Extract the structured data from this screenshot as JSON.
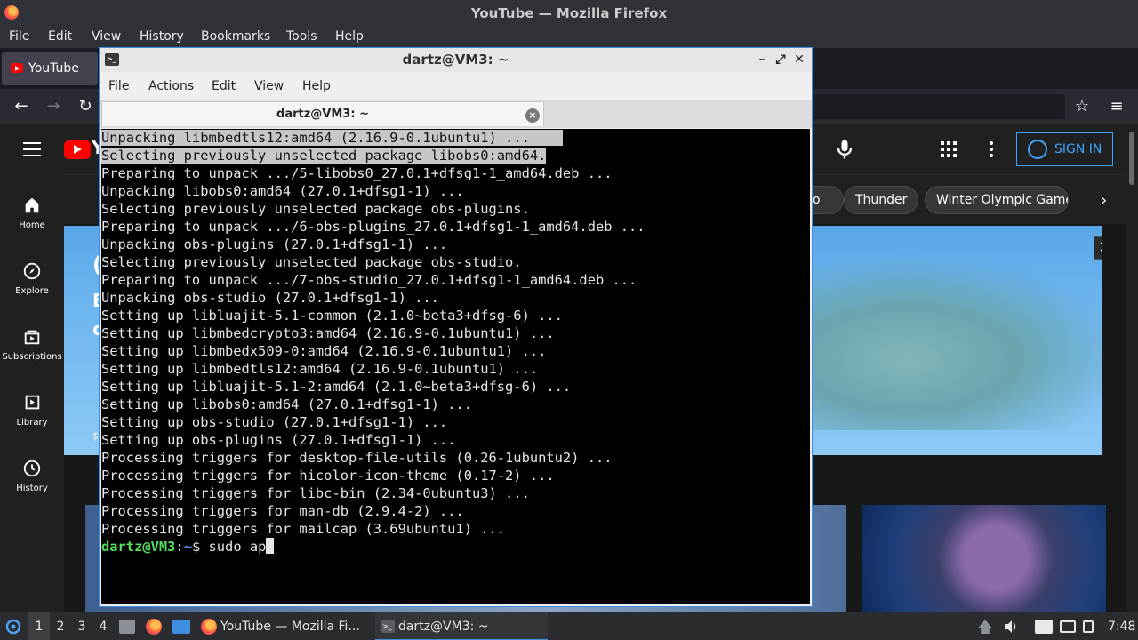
{
  "firefox": {
    "window_title": "YouTube — Mozilla Firefox",
    "menu": [
      "File",
      "Edit",
      "View",
      "History",
      "Bookmarks",
      "Tools",
      "Help"
    ],
    "tab_label": "YouTube"
  },
  "youtube": {
    "sign_in": "SIGN IN",
    "sidebar": [
      {
        "label": "Home",
        "icon": "home-icon"
      },
      {
        "label": "Explore",
        "icon": "compass-icon"
      },
      {
        "label": "Subscriptions",
        "icon": "subscriptions-icon"
      },
      {
        "label": "Library",
        "icon": "library-icon"
      },
      {
        "label": "History",
        "icon": "history-icon"
      }
    ],
    "chips": [
      "o",
      "Thunder",
      "Winter Olympic Games"
    ],
    "logo_partial": "Y",
    "banner_fragments": [
      "(",
      "E",
      "c",
      "$"
    ]
  },
  "terminal": {
    "window_title": "dartz@VM3: ~",
    "menu": [
      "File",
      "Actions",
      "Edit",
      "View",
      "Help"
    ],
    "tab_title": "dartz@VM3: ~",
    "selected_lines": [
      {
        "sel": "Unpacking libmbedtls12:amd64 (2.16.9-0.1ubuntu1) ...    ",
        "rest": ""
      },
      {
        "sel": "Selecting previously unselected package libobs0:amd64.",
        "rest": ""
      }
    ],
    "lines": [
      "Preparing to unpack .../5-libobs0_27.0.1+dfsg1-1_amd64.deb ...",
      "Unpacking libobs0:amd64 (27.0.1+dfsg1-1) ...",
      "Selecting previously unselected package obs-plugins.",
      "Preparing to unpack .../6-obs-plugins_27.0.1+dfsg1-1_amd64.deb ...",
      "Unpacking obs-plugins (27.0.1+dfsg1-1) ...",
      "Selecting previously unselected package obs-studio.",
      "Preparing to unpack .../7-obs-studio_27.0.1+dfsg1-1_amd64.deb ...",
      "Unpacking obs-studio (27.0.1+dfsg1-1) ...",
      "Setting up libluajit-5.1-common (2.1.0~beta3+dfsg-6) ...",
      "Setting up libmbedcrypto3:amd64 (2.16.9-0.1ubuntu1) ...",
      "Setting up libmbedx509-0:amd64 (2.16.9-0.1ubuntu1) ...",
      "Setting up libmbedtls12:amd64 (2.16.9-0.1ubuntu1) ...",
      "Setting up libluajit-5.1-2:amd64 (2.1.0~beta3+dfsg-6) ...",
      "Setting up libobs0:amd64 (27.0.1+dfsg1-1) ...",
      "Setting up obs-studio (27.0.1+dfsg1-1) ...",
      "Setting up obs-plugins (27.0.1+dfsg1-1) ...",
      "Processing triggers for desktop-file-utils (0.26-1ubuntu2) ...",
      "Processing triggers for hicolor-icon-theme (0.17-2) ...",
      "Processing triggers for libc-bin (2.34-0ubuntu3) ...",
      "Processing triggers for man-db (2.9.4-2) ...",
      "Processing triggers for mailcap (3.69ubuntu1) ..."
    ],
    "prompt_user": "dartz@VM3",
    "prompt_sep": ":",
    "prompt_path": "~",
    "prompt_symbol": "$ ",
    "command": "sudo ap"
  },
  "taskbar": {
    "workspaces": [
      "1",
      "2",
      "3",
      "4"
    ],
    "tasks": [
      "YouTube — Mozilla Fi...",
      "dartz@VM3: ~"
    ],
    "clock": "7:48"
  },
  "colors": {
    "accent": "#3d8ee0",
    "yt_red": "#ff0000",
    "yt_blue": "#3ea6ff",
    "prompt_green": "#55dc5a",
    "prompt_blue": "#5e8fff"
  }
}
